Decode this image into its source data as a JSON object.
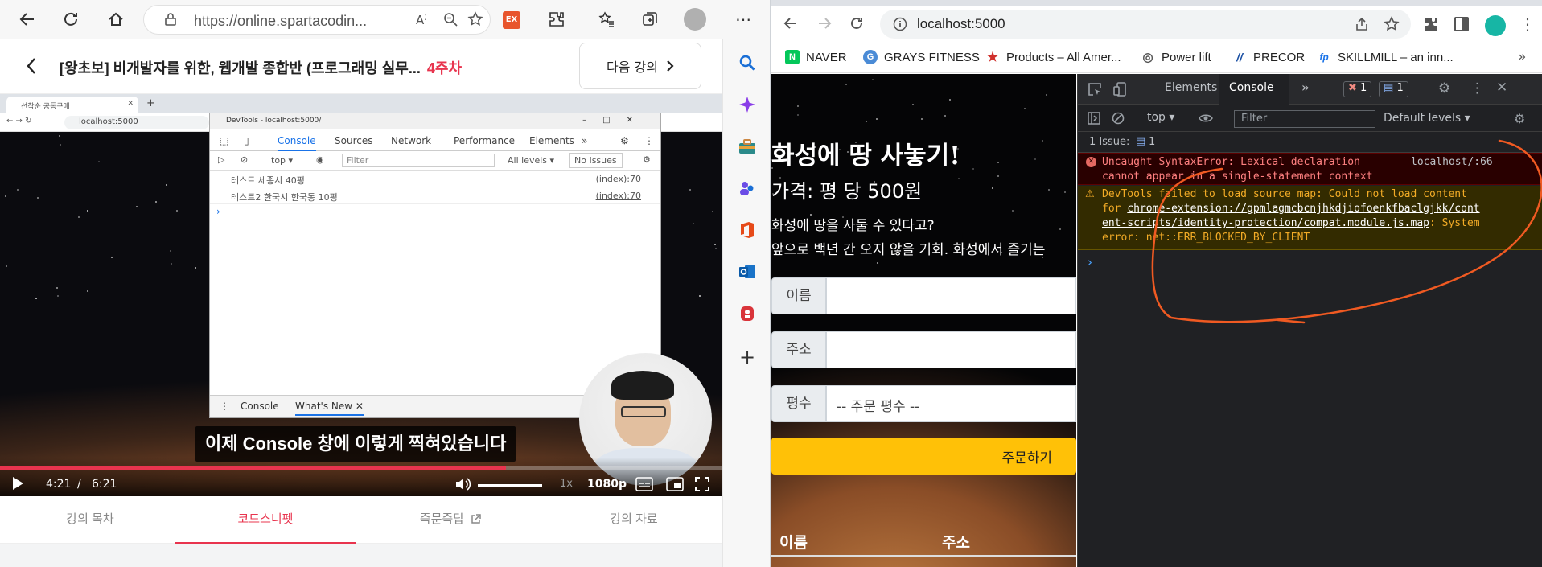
{
  "left_browser": {
    "url": "https://online.spartacodin...",
    "ext_label": "EX"
  },
  "course": {
    "title": "[왕초보] 비개발자를 위한, 웹개발 종합반 (프로그래밍 실무...",
    "week": "4주차",
    "next_label": "다음 강의"
  },
  "video": {
    "inner_tab_title": "선착순 공동구매",
    "inner_url": "localhost:5000",
    "mini_devtools": {
      "title": "DevTools - localhost:5000/",
      "tabs": [
        "Console",
        "Sources",
        "Network",
        "Performance",
        "Elements"
      ],
      "more": "»",
      "context": "top",
      "filter_placeholder": "Filter",
      "levels": "All levels",
      "issues": "No Issues",
      "rows": [
        {
          "msg": "테스트 세종시 40평",
          "src": "(index):70"
        },
        {
          "msg": "테스트2 한국시 한국동 10평",
          "src": "(index):70"
        }
      ],
      "prompt": "›",
      "drawer_tabs": [
        "Console",
        "What's New"
      ]
    },
    "subtitle": "이제 Console 창에 이렇게 찍혀있습니다",
    "time_current": "4:21",
    "time_sep": "/",
    "time_total": "6:21",
    "progress": 0.7,
    "speed": "1x",
    "quality": "1080p"
  },
  "course_tabs": [
    {
      "label": "강의 목차",
      "active": false
    },
    {
      "label": "코드스니펫",
      "active": true
    },
    {
      "label": "즉문즉답",
      "active": false
    },
    {
      "label": "강의 자료",
      "active": false
    }
  ],
  "sidebar_icons": [
    "search-icon",
    "sparkle-icon",
    "toolbox-icon",
    "people-icon",
    "office-icon",
    "outlook-icon",
    "tool-icon",
    "add-icon"
  ],
  "right_browser": {
    "url": "localhost:5000",
    "bookmarks": [
      {
        "label": "NAVER",
        "icon": "N",
        "color": "#03c75a"
      },
      {
        "label": "GRAYS FITNESS",
        "icon": "G",
        "color": "#4a8bd6"
      },
      {
        "label": "Products – All Amer...",
        "icon": "★",
        "color": "#d0312d"
      },
      {
        "label": "Power lift",
        "icon": "◎",
        "color": "#555555"
      },
      {
        "label": "PRECOR",
        "icon": "//",
        "color": "#1a4fa3"
      },
      {
        "label": "SKILLMILL – an inn...",
        "icon": "fp",
        "color": "#1a73e8"
      }
    ],
    "more_bookmarks": "»"
  },
  "mars_page": {
    "title": "화성에 땅 사놓기!",
    "price": "가격: 평 당 500원",
    "desc1": "화성에 땅을 사둘 수 있다고?",
    "desc2": "앞으로 백년 간 오지 않을 기회. 화성에서 즐기는",
    "name_label": "이름",
    "address_label": "주소",
    "size_label": "평수",
    "size_placeholder": "-- 주문 평수 --",
    "order_button": "주문하기",
    "table_headers": [
      "이름",
      "주소"
    ]
  },
  "devtools": {
    "tabs": [
      "Elements",
      "Console"
    ],
    "more": "»",
    "error_count": "1",
    "message_count": "1",
    "context": "top",
    "filter_placeholder": "Filter",
    "levels": "Default levels",
    "issues": "1 Issue:",
    "issues_count": "1",
    "error": {
      "line1": "Uncaught SyntaxError: Lexical declaration",
      "line2": "cannot appear in a single-statement context",
      "source": "localhost/:66"
    },
    "warning": {
      "line1": "DevTools failed to load source map: Could not load content",
      "line2_prefix": "for ",
      "line2_link": "chrome-extension://gpmlagmcbcnjhkdjiofoenkfbaclgjkk/cont",
      "line3_link": "ent-scripts/identity-protection/compat.module.js.map",
      "line3_suffix": ": System",
      "line4": "error: net::ERR_BLOCKED_BY_CLIENT"
    },
    "prompt": "›"
  },
  "colors": {
    "accent_red": "#e8344e",
    "order_yellow": "#ffc107",
    "annotation_orange": "#f05a22"
  }
}
